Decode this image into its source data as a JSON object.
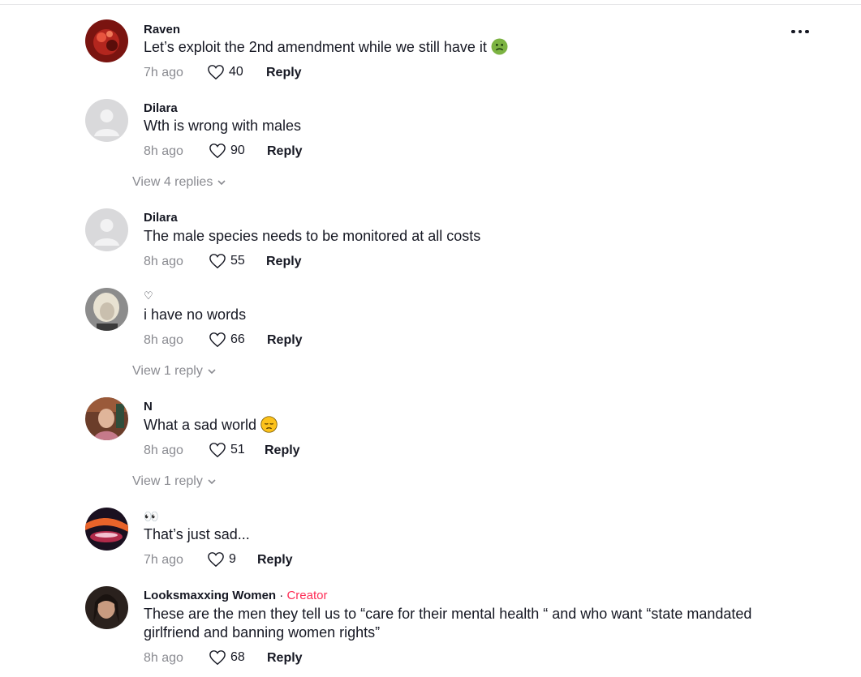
{
  "comments": [
    {
      "user": "Raven",
      "text": "Let’s exploit the 2nd amendment while we still have it",
      "emoji": "nauseated-face-icon",
      "time": "7h ago",
      "likes": "40",
      "reply": "Reply"
    },
    {
      "user": "Dilara",
      "text": "Wth is wrong with males",
      "time": "8h ago",
      "likes": "90",
      "reply": "Reply",
      "view_replies": "View 4 replies"
    },
    {
      "user": "Dilara",
      "text": "The male species needs to be monitored at all costs",
      "time": "8h ago",
      "likes": "55",
      "reply": "Reply"
    },
    {
      "user": "♡",
      "text": "i have no words",
      "time": "8h ago",
      "likes": "66",
      "reply": "Reply",
      "view_replies": "View 1 reply"
    },
    {
      "user": "N",
      "text": "What a sad world",
      "emoji": "downcast-face-icon",
      "time": "8h ago",
      "likes": "51",
      "reply": "Reply",
      "view_replies": "View 1 reply"
    },
    {
      "user": "👀",
      "text": "That’s just sad...",
      "time": "7h ago",
      "likes": "9",
      "reply": "Reply"
    },
    {
      "user": "Looksmaxxing Women",
      "separator": " · ",
      "badge": "Creator",
      "text": "These are the men they tell us to “care for their mental health “ and who want “state mandated girlfriend and banning women rights”",
      "time": "8h ago",
      "likes": "68",
      "reply": "Reply"
    }
  ],
  "colors": {
    "text": "#161823",
    "muted": "#8a8b91",
    "creator": "#fe2c55"
  }
}
